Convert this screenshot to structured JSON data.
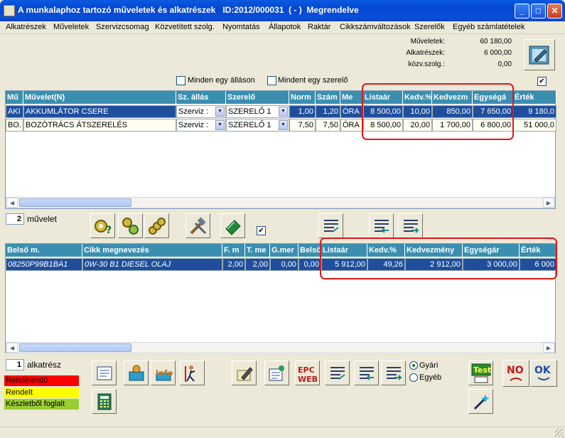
{
  "window": {
    "title": "A munkalaphoz tartozó műveletek és alkatrészek   ID:2012/000031  ( - )  Megrendelve",
    "controls": {
      "minimize": "_",
      "maximize": "□",
      "close": "✕"
    }
  },
  "menu": [
    "Alkatrészek",
    "Műveletek",
    "Szervizcsomag",
    "Közvetített szolg.",
    "Nyomtatás",
    "Állapotok",
    "Raktár",
    "Cikkszámváltozások",
    "Szerelők",
    "Egyéb számlatételek"
  ],
  "summary": [
    {
      "label": "Műveletek:",
      "value": "60 180,00"
    },
    {
      "label": "Alkatrészek:",
      "value": "6 000,00"
    },
    {
      "label": "közv.szolg.:",
      "value": "0,00"
    }
  ],
  "filters": {
    "every_state": "Minden egy álláson",
    "every_mechanic": "Mindent egy szerelő"
  },
  "operations": {
    "headers": [
      "Mű",
      "Művelet(N)",
      "Sz. állás",
      "Szerelő",
      "Norm",
      "Szám",
      "Me",
      "Listaár",
      "Kedv.%",
      "Kedvezm",
      "Egységá",
      "Érték"
    ],
    "rows": [
      [
        "AKI",
        "AKKUMLÁTOR CSERE",
        "Szerviz :",
        "SZERELŐ 1",
        "1,00",
        "1,20",
        "ÓRA",
        "8 500,00",
        "10,00",
        "850,00",
        "7 650,00",
        "9 180,0"
      ],
      [
        "BO.",
        "BOZÓTRÁCS ÁTSZERELÉS",
        "Szerviz :",
        "SZERELŐ 1",
        "7,50",
        "7,50",
        "ÓRA",
        "8 500,00",
        "20,00",
        "1 700,00",
        "6 800,00",
        "51 000,0"
      ]
    ],
    "count": "2",
    "count_label": "művelet"
  },
  "parts": {
    "headers": [
      "Belső m.",
      "Cikk megnevezés",
      "F. m",
      "T. me",
      "G.mer",
      "Belső",
      "Listaár",
      "Kedv.%",
      "Kedvezmény",
      "Egységár",
      "Érték"
    ],
    "rows": [
      [
        "08250P99B1BA1",
        "0W-30 B1 DIESEL OLAJ",
        "2,00",
        "2,00",
        "0,00",
        "0,00",
        "5 912,00",
        "49,26",
        "2 912,00",
        "3 000,00",
        "6 000"
      ]
    ],
    "count": "1",
    "count_label": "alkatrész"
  },
  "legend": [
    {
      "label": "Rendelendő",
      "color": "#ff0000"
    },
    {
      "label": "Rendelt",
      "color": "#ffff00"
    },
    {
      "label": "Készletből foglalt",
      "color": "#9acd32"
    }
  ],
  "source_options": {
    "factory": "Gyári",
    "other": "Egyéb",
    "selected": "Gyári"
  },
  "buttons": {
    "test": "Test",
    "no": "NO",
    "ok": "OK",
    "info": "Info",
    "epc": "EPC WEB"
  }
}
